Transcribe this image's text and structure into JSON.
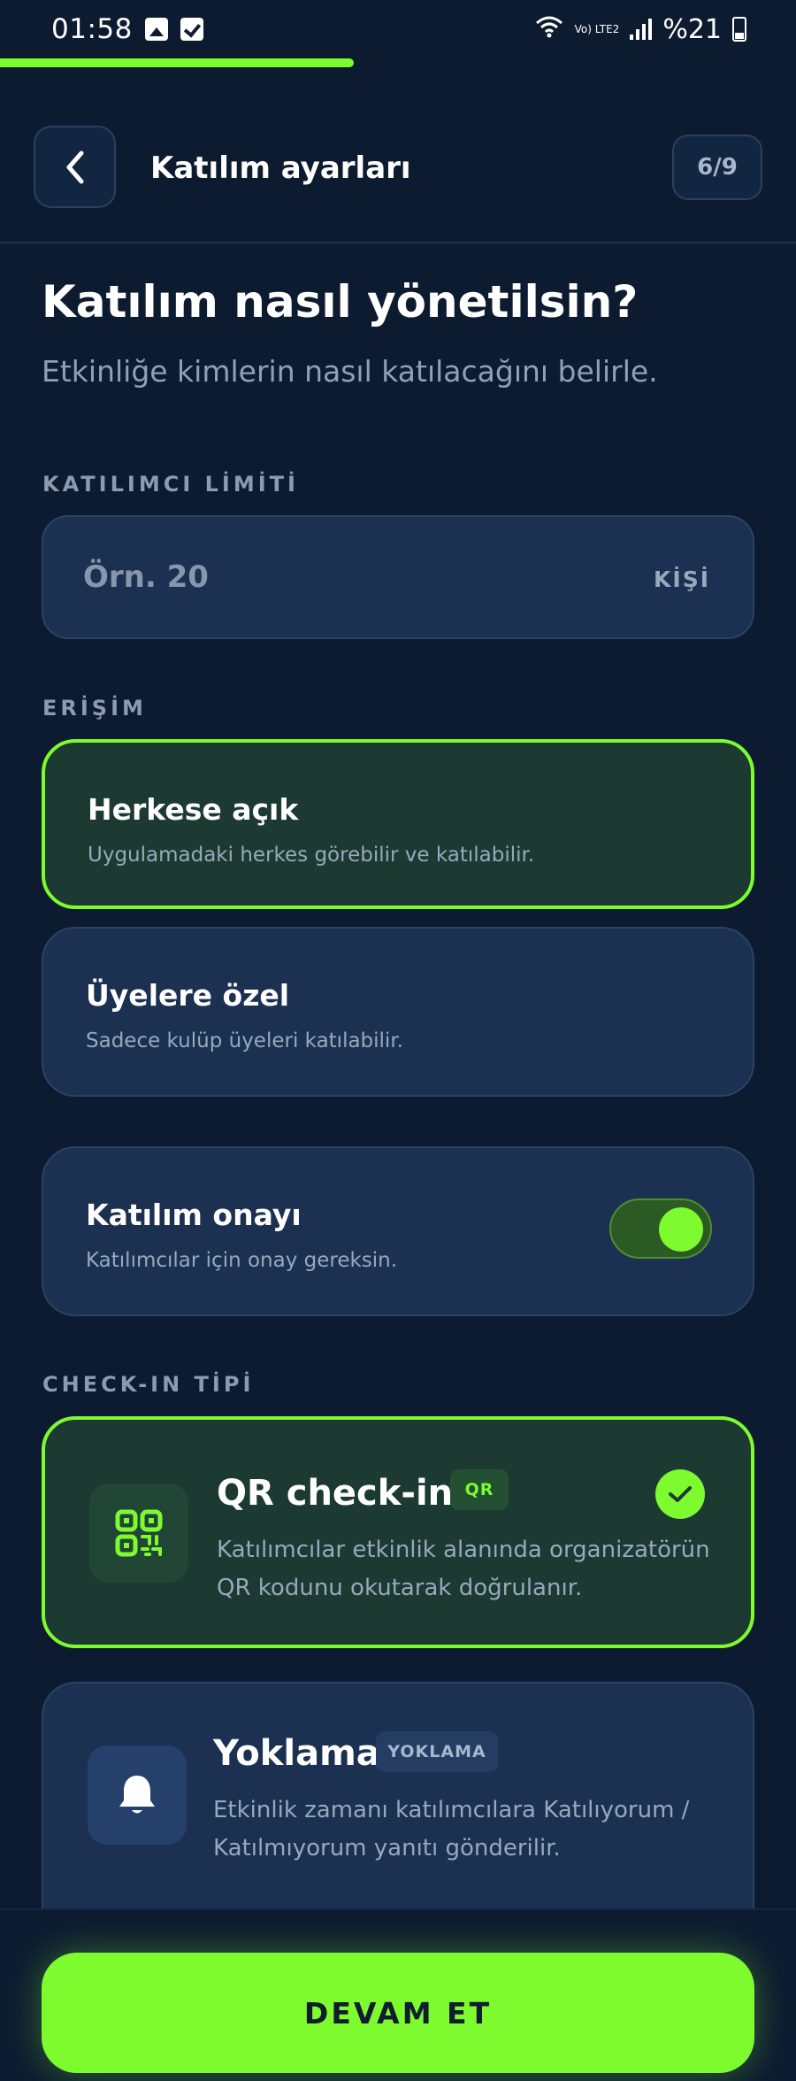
{
  "status_bar": {
    "time": "01:58",
    "network": "Vo) LTE2",
    "battery": "%21"
  },
  "progress": {
    "fraction": 0.444
  },
  "header": {
    "title": "Katılım ayarları",
    "step": "6/9"
  },
  "page": {
    "title": "Katılım nasıl yönetilsin?",
    "subtitle": "Etkinliğe kimlerin nasıl katılacağını belirle."
  },
  "limit": {
    "label": "KATILIMCI LİMİTİ",
    "placeholder": "Örn. 20",
    "unit": "KİŞİ"
  },
  "access": {
    "label": "ERİŞİM",
    "options": [
      {
        "title": "Herkese açık",
        "desc": "Uygulamadaki herkes görebilir ve katılabilir.",
        "selected": true
      },
      {
        "title": "Üyelere özel",
        "desc": "Sadece kulüp üyeleri katılabilir.",
        "selected": false
      }
    ]
  },
  "approval": {
    "title": "Katılım onayı",
    "desc": "Katılımcılar için onay gereksin.",
    "enabled": true
  },
  "checkin": {
    "label": "CHECK-IN TİPİ",
    "options": [
      {
        "title": "QR check-in",
        "tag": "QR",
        "desc": "Katılımcılar etkinlik alanında organizatörün QR kodunu okutarak doğrulanır.",
        "icon": "qr-code-icon",
        "selected": true
      },
      {
        "title": "Yoklama",
        "tag": "YOKLAMA",
        "desc": "Etkinlik zamanı katılımcılara Katılıyorum / Katılmıyorum yanıtı gönderilir.",
        "icon": "bell-icon",
        "selected": false
      }
    ]
  },
  "cta": {
    "label": "DEVAM ET"
  },
  "colors": {
    "accent": "#7dfb2e",
    "background": "#0d1b30",
    "card": "#1c3152",
    "selected_card": "#1c3a32"
  }
}
